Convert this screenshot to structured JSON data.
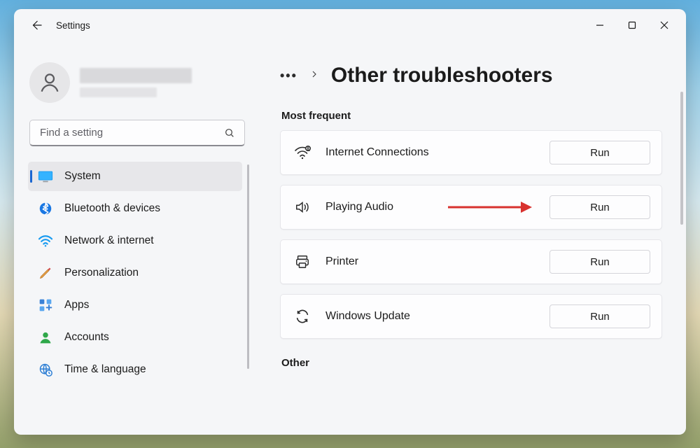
{
  "window": {
    "title": "Settings"
  },
  "search": {
    "placeholder": "Find a setting"
  },
  "sidebar": {
    "items": [
      {
        "label": "System"
      },
      {
        "label": "Bluetooth & devices"
      },
      {
        "label": "Network & internet"
      },
      {
        "label": "Personalization"
      },
      {
        "label": "Apps"
      },
      {
        "label": "Accounts"
      },
      {
        "label": "Time & language"
      }
    ],
    "active_index": 0
  },
  "breadcrumb": {
    "page_title": "Other troubleshooters"
  },
  "sections": {
    "most_frequent": {
      "heading": "Most frequent",
      "items": [
        {
          "label": "Internet Connections",
          "button": "Run"
        },
        {
          "label": "Playing Audio",
          "button": "Run"
        },
        {
          "label": "Printer",
          "button": "Run"
        },
        {
          "label": "Windows Update",
          "button": "Run"
        }
      ]
    },
    "other": {
      "heading": "Other"
    }
  },
  "annotation": {
    "target_item_index": 1
  }
}
